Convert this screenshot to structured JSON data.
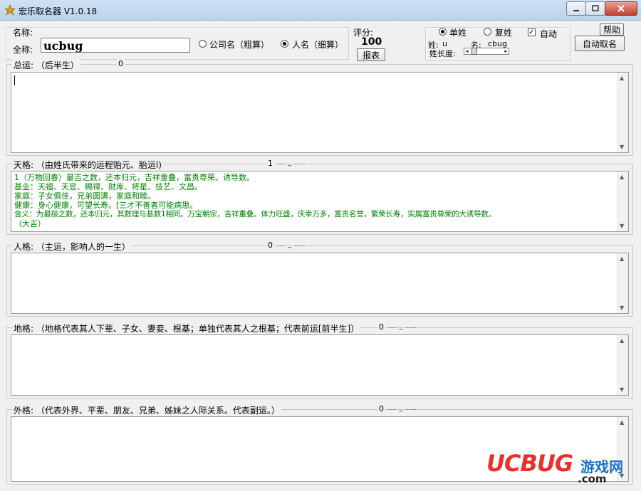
{
  "window": {
    "title": "宏乐取名器 V1.0.18",
    "icon": "app-logo-icon",
    "controls": [
      "minimize-icon",
      "maximize-icon",
      "close-icon"
    ]
  },
  "form": {
    "name_label": "名称:",
    "fullname_label": "全称:",
    "fullname_value": "ucbug",
    "option_company": "公司名（粗算）",
    "option_person": "人名（细算）",
    "selected_option": "person",
    "score_label": "评分:",
    "score_value": "100",
    "report_button": "报表",
    "single_surname": "单姓",
    "double_surname": "复姓",
    "surname_mode": "single",
    "auto_label": "自动",
    "auto_checked": true,
    "surname_label": "姓:",
    "surname_value": "u",
    "given_label": "名:",
    "given_value": "cbug",
    "surname_length_label": "姓长度:",
    "help_button": "帮助",
    "auto_name_button": "自动取名"
  },
  "sections": {
    "zongyun": {
      "title": "总运: （后半生）",
      "count": "0",
      "dots": "",
      "lines": []
    },
    "tiange": {
      "title": "天格: （由姓氏带来的运程贻元、胎运l)",
      "count": "1",
      "dots": "... _ ....",
      "lines": [
        "1（万物回春）最吉之数，还本归元，吉祥重叠，富贵尊荣。诱导数。",
        "基业：天福、天官、赐禄、财库、将星、技艺、文昌。",
        "家庭：子女俱佳，兄弟圆满，家庭和睦。",
        "健康：身心健康，可望长寿。[三才不善者可能病患。",
        "含义：为最极之数，还本归元，其数理与基数1相同。万宝朝宗，吉祥重叠。体力旺盛，庆幸万多，富贵名誉，繁荣长寿，实属富贵尊荣的大诱导数。",
        "（大吉）"
      ]
    },
    "renge": {
      "title": "人格: （主运，影响人的一生）",
      "count": "0",
      "dots": "... _ ....",
      "lines": []
    },
    "dige": {
      "title": "地格: （地格代表其人下辈、子女、妻妾、根基；单独代表其人之根基；代表前运[前半生]）",
      "count": "0",
      "dots": "... _ ....",
      "lines": []
    },
    "waige": {
      "title": "外格: （代表外界、平辈、朋友、兄弟、姊妹之人际关系。代表副运。）",
      "count": "0",
      "dots": "... _ ....",
      "lines": []
    }
  },
  "watermark": {
    "brand": "UCBUG",
    "sub": "游戏网",
    "domain": ".com"
  },
  "colors": {
    "content_text": "#008000",
    "brand_red": "#e8312a",
    "brand_blue": "#1a6fc4"
  }
}
